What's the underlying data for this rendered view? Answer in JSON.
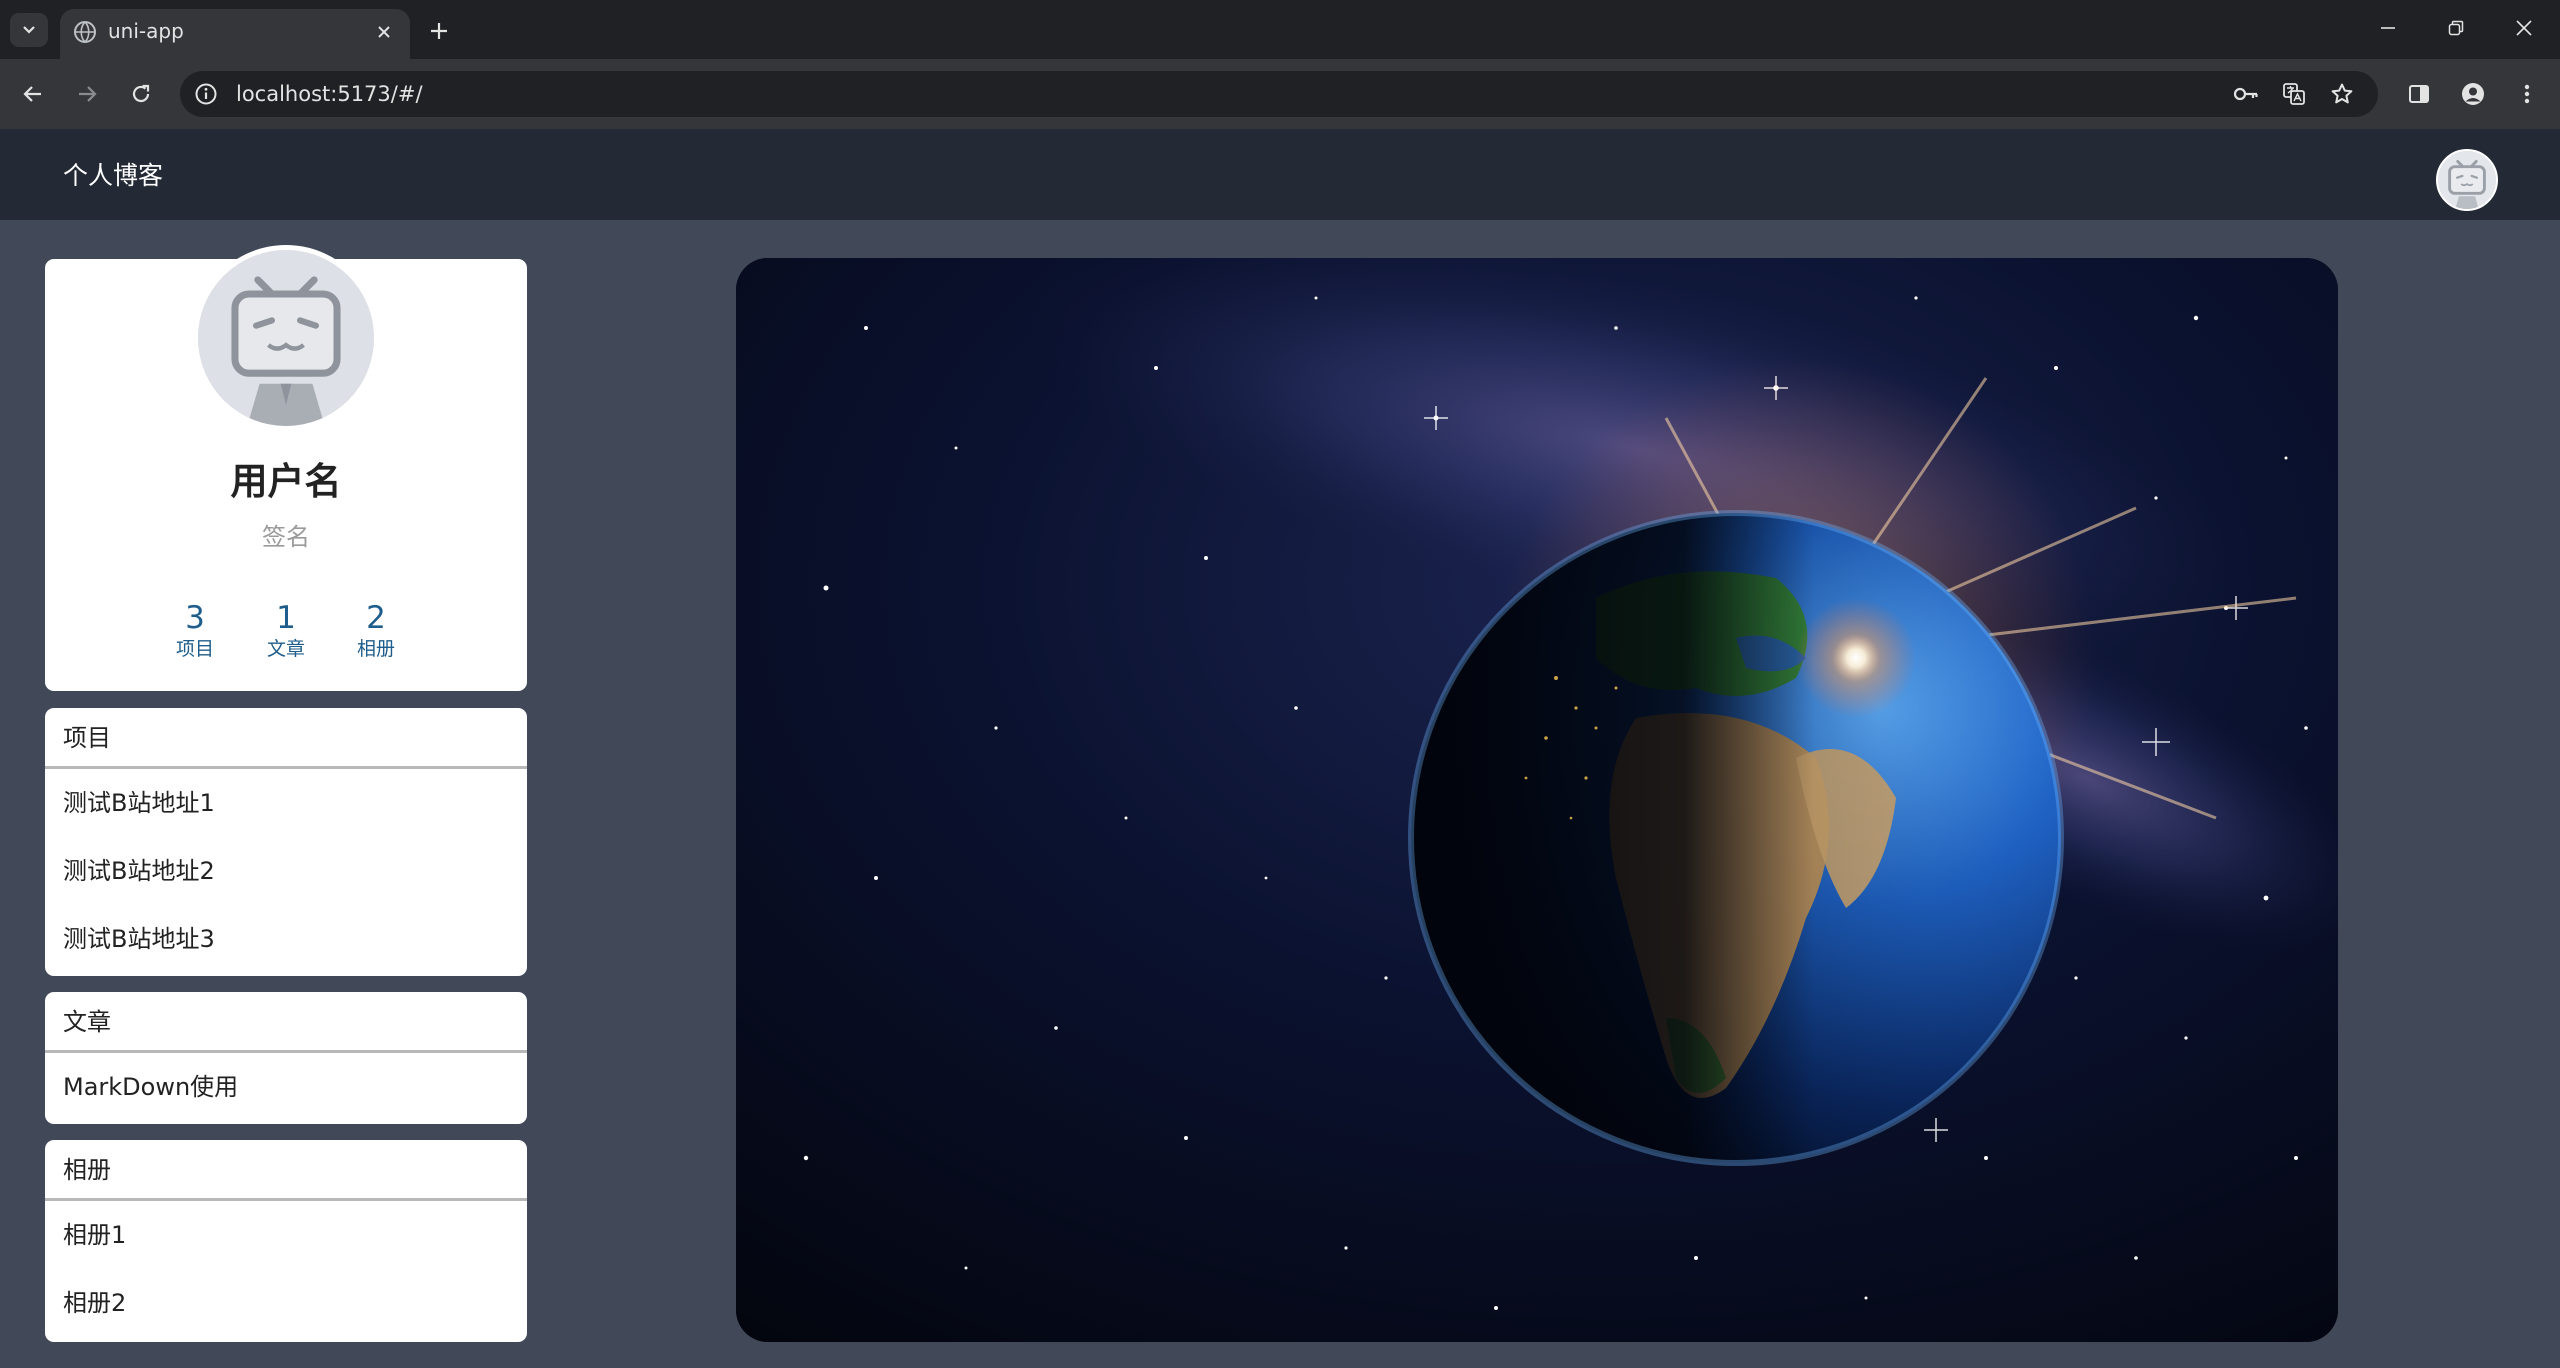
{
  "browser": {
    "tab_title": "uni-app",
    "url": "localhost:5173/#/"
  },
  "app": {
    "site_title": "个人博客"
  },
  "profile": {
    "username": "用户名",
    "signature": "签名",
    "stats": [
      {
        "value": "3",
        "label": "项目"
      },
      {
        "value": "1",
        "label": "文章"
      },
      {
        "value": "2",
        "label": "相册"
      }
    ]
  },
  "sections": {
    "projects": {
      "title": "项目",
      "items": [
        "测试B站地址1",
        "测试B站地址2",
        "测试B站地址3"
      ]
    },
    "articles": {
      "title": "文章",
      "items": [
        "MarkDown使用"
      ]
    },
    "albums": {
      "title": "相册",
      "items": [
        "相册1",
        "相册2"
      ]
    }
  },
  "colors": {
    "page_bg": "#414958",
    "header_bg": "#232a36",
    "stat_color": "#1f5e8c"
  },
  "icons": [
    "tab-search-icon",
    "globe-icon",
    "close-icon",
    "plus-icon",
    "minimize-icon",
    "restore-icon",
    "back-icon",
    "forward-icon",
    "reload-icon",
    "info-icon",
    "password-key-icon",
    "translate-icon",
    "star-icon",
    "side-panel-icon",
    "profile-icon",
    "more-icon",
    "tv-mascot-icon"
  ]
}
